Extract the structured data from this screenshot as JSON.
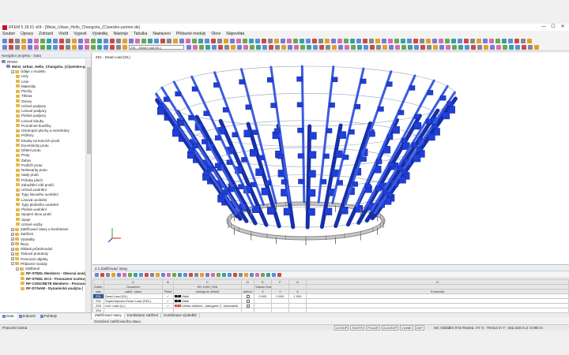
{
  "window": {
    "title": "RFEM 5.18.01 x64 - [Meisi_Urban_Hello_Changsha_(C)weiske-partner.de]",
    "controls": [
      "—",
      "☐",
      "✕"
    ]
  },
  "menu": [
    "Soubor",
    "Úpravy",
    "Zobrazit",
    "Vložit",
    "Vygo­vit",
    "Výsledky",
    "Nástroje",
    "Tabulka",
    "Nastavení",
    "Přídavné moduly",
    "Okno",
    "Nápověda"
  ],
  "toolbar": {
    "load_case": "Z51 - Dead Load (DL)"
  },
  "navigator": {
    "title": "Navigátor projektu - Data",
    "items": [
      {
        "label": "RFEM",
        "level": 0,
        "kind": "root"
      },
      {
        "label": "Meisi_Urban_Hello_Changsha_(C)weiske-par",
        "level": 1,
        "kind": "project",
        "bold": true
      },
      {
        "label": "Údaje o modelu",
        "level": 2,
        "kind": "folder"
      },
      {
        "label": "Uzly",
        "level": 3,
        "kind": "folder"
      },
      {
        "label": "Linie",
        "level": 3,
        "kind": "folder"
      },
      {
        "label": "Materiály",
        "level": 3,
        "kind": "folder"
      },
      {
        "label": "Plochy",
        "level": 3,
        "kind": "folder"
      },
      {
        "label": "Tělesa",
        "level": 3,
        "kind": "folder"
      },
      {
        "label": "Otvory",
        "level": 3,
        "kind": "folder"
      },
      {
        "label": "Uzlové podpory",
        "level": 3,
        "kind": "folder"
      },
      {
        "label": "Liniové podpory",
        "level": 3,
        "kind": "folder"
      },
      {
        "label": "Plošné podpory",
        "level": 3,
        "kind": "folder"
      },
      {
        "label": "Liniové klouby",
        "level": 3,
        "kind": "folder"
      },
      {
        "label": "Proměnné tloušťky",
        "level": 3,
        "kind": "folder"
      },
      {
        "label": "Ortotropní plochy a membrány",
        "level": 3,
        "kind": "folder"
      },
      {
        "label": "Průřezy",
        "level": 3,
        "kind": "folder"
      },
      {
        "label": "Klouby na koncích prutů",
        "level": 3,
        "kind": "folder"
      },
      {
        "label": "Excentricity prutu",
        "level": 3,
        "kind": "folder"
      },
      {
        "label": "Dělení prutu",
        "level": 3,
        "kind": "folder"
      },
      {
        "label": "Pruty",
        "level": 3,
        "kind": "folder"
      },
      {
        "label": "Žebra",
        "level": 3,
        "kind": "folder"
      },
      {
        "label": "Podloží prutu",
        "level": 3,
        "kind": "folder"
      },
      {
        "label": "Nelinearity prutu",
        "level": 3,
        "kind": "folder"
      },
      {
        "label": "Sady prutů",
        "level": 3,
        "kind": "folder"
      },
      {
        "label": "Průniky ploch",
        "level": 3,
        "kind": "folder"
      },
      {
        "label": "Zahuštění sítě prvků",
        "level": 3,
        "kind": "folder"
      },
      {
        "label": "Uzlová uvolnění",
        "level": 3,
        "kind": "folder"
      },
      {
        "label": "Typy liniového uvolnění",
        "level": 3,
        "kind": "folder"
      },
      {
        "label": "Liniová uvolnění",
        "level": 3,
        "kind": "folder"
      },
      {
        "label": "Typy plošného uvolnění",
        "level": 3,
        "kind": "folder"
      },
      {
        "label": "Plošná uvolnění",
        "level": 3,
        "kind": "folder"
      },
      {
        "label": "Spojení dvou prutů",
        "level": 3,
        "kind": "folder"
      },
      {
        "label": "Spoje",
        "level": 3,
        "kind": "folder"
      },
      {
        "label": "Uzlové vazby",
        "level": 3,
        "kind": "folder"
      },
      {
        "label": "Zatěžovací stavy a kombinace",
        "level": 2,
        "kind": "folder"
      },
      {
        "label": "Zatížení",
        "level": 2,
        "kind": "folder"
      },
      {
        "label": "Výsledky",
        "level": 2,
        "kind": "folder"
      },
      {
        "label": "Řezy",
        "level": 2,
        "kind": "folder"
      },
      {
        "label": "Oblasti průměrování",
        "level": 2,
        "kind": "folder"
      },
      {
        "label": "Tiskové protokoly",
        "level": 2,
        "kind": "folder"
      },
      {
        "label": "Pomocné objekty",
        "level": 2,
        "kind": "folder"
      },
      {
        "label": "Přídavné moduly",
        "level": 2,
        "kind": "folder"
      },
      {
        "label": "Oblíbené",
        "level": 3,
        "kind": "folder"
      },
      {
        "label": "RF-STEEL Members - Obecná analý",
        "level": 4,
        "kind": "module",
        "bold": true
      },
      {
        "label": "RF-STEEL EC3 - Posouzení ocelový",
        "level": 4,
        "kind": "module red",
        "bold": true
      },
      {
        "label": "RF-CONCRETE Members - Posouze",
        "level": 4,
        "kind": "module grn",
        "bold": true
      },
      {
        "label": "RF-DYNAM - Dynamická analýza (",
        "level": 4,
        "kind": "module org",
        "bold": true
      }
    ],
    "tabs": [
      "Data",
      "Zobrazit",
      "Pohledy"
    ]
  },
  "viewport": {
    "caption": "Z51 - Dead Load (DL)"
  },
  "table": {
    "title": "2.1 Zatěžovací stavy",
    "col_letters": [
      "",
      "A",
      "B",
      "C",
      "D",
      "E",
      "F",
      "G",
      "H"
    ],
    "head1": [
      "Zatěž.",
      "Označení",
      "",
      "EN 1990 | DIN",
      "",
      "Vlastní tíha - součinitel ve směru",
      "",
      "",
      ""
    ],
    "head2": [
      "stav",
      "zatěž. stavu",
      "Řešit",
      "Kategorie účinků",
      "Aktivní",
      "X",
      "Y",
      "Z",
      "Komentář"
    ],
    "rows": [
      {
        "id": "Z51",
        "name": "Dead Load (DL)",
        "solve": "✓",
        "cat_code": "G",
        "cat": "Stálé",
        "active": "☑",
        "x": "0.000",
        "y": "0.000",
        "z": "1.000",
        "comment": "",
        "sel": true
      },
      {
        "id": "Z52",
        "name": "Superimposed Dead Load (SDL)",
        "solve": "✓",
        "cat_code": "G",
        "cat": "Stálé",
        "active": "",
        "x": "",
        "y": "",
        "z": "",
        "comment": ""
      },
      {
        "id": "Z53",
        "name": "Live Load (LL)",
        "solve": "✓",
        "cat_code": "QI A",
        "cat": "Užitná zatížení - kategorie C: shromaždi",
        "active": "",
        "x": "",
        "y": "",
        "z": "",
        "comment": ""
      },
      {
        "id": "Z54",
        "name": "",
        "solve": "",
        "cat_code": "",
        "cat": "",
        "active": "",
        "x": "",
        "y": "",
        "z": "",
        "comment": ""
      }
    ],
    "tabs": [
      "Zatěžovací stavy",
      "Kombinace zatížení",
      "Kombinace výsledků"
    ]
  },
  "hint": "Označení zatěžovacího stavu",
  "status": {
    "message": "Pracovní rovina",
    "buttons": [
      "UCHOP",
      "RASTR",
      "POLÁR",
      "GUCHOP",
      "VLINIE",
      "DXF"
    ],
    "coords": "SS: Globální XYZ  Rovina: XY      X: -79.614 m    Y: -152.318 m    Z: 0.000 m"
  },
  "colors": {
    "member_blue": "#1f3fd8",
    "member_dark": "#1530a8",
    "selected_row": "#2b5797",
    "cat_black": "#111111",
    "cat_red": "#c0392b"
  }
}
